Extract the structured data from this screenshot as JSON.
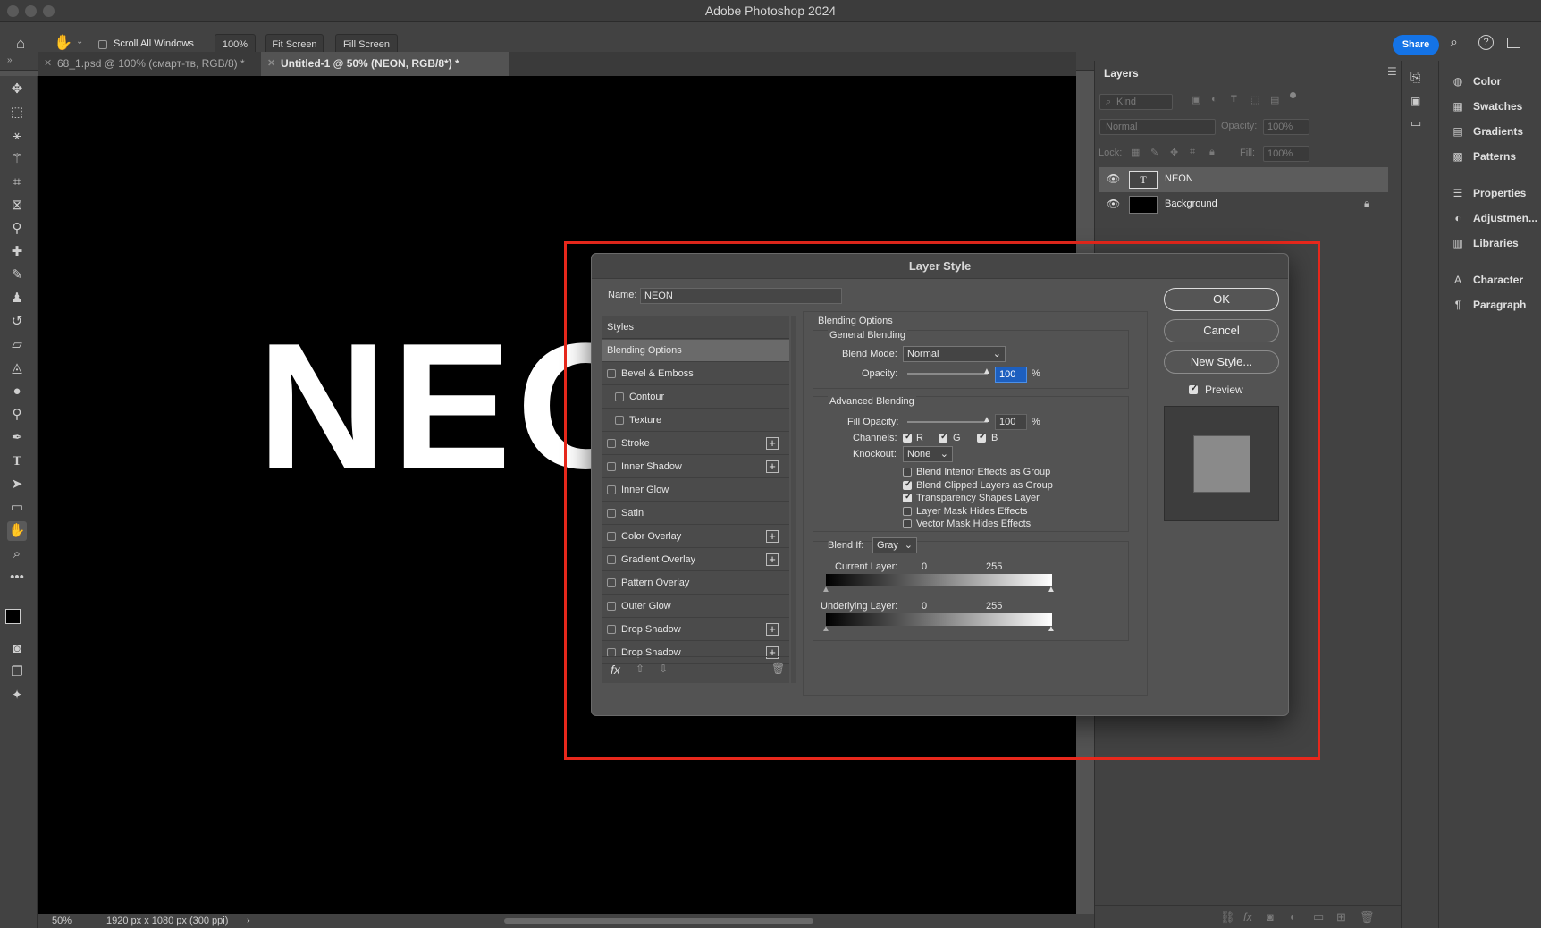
{
  "app": {
    "title": "Adobe Photoshop 2024"
  },
  "options_bar": {
    "scroll_all_windows": "Scroll All Windows",
    "zoom": "100%",
    "fit_screen": "Fit Screen",
    "fill_screen": "Fill Screen",
    "share": "Share"
  },
  "tabs": [
    {
      "label": "68_1.psd @ 100% (смарт-тв, RGB/8) *",
      "active": false
    },
    {
      "label": "Untitled-1 @ 50% (NEON, RGB/8*) *",
      "active": true
    }
  ],
  "canvas": {
    "text": "NEO"
  },
  "status": {
    "zoom": "50%",
    "dims": "1920 px x 1080 px (300 ppi)",
    "arrow": "›"
  },
  "layers_panel": {
    "title": "Layers",
    "kind": "Kind",
    "blend_mode": "Normal",
    "opacity_label": "Opacity:",
    "opacity_value": "100%",
    "lock_label": "Lock:",
    "fill_label": "Fill:",
    "fill_value": "100%",
    "layers": [
      {
        "name": "NEON",
        "type": "text",
        "selected": true
      },
      {
        "name": "Background",
        "type": "fill",
        "locked": true
      }
    ]
  },
  "side_panels": {
    "items": [
      "Color",
      "Swatches",
      "Gradients",
      "Patterns",
      "Properties",
      "Adjustmen...",
      "Libraries",
      "Character",
      "Paragraph"
    ]
  },
  "dialog": {
    "title": "Layer Style",
    "name_label": "Name:",
    "name_value": "NEON",
    "styles_header": "Styles",
    "styles": [
      {
        "label": "Blending Options",
        "checkbox": false,
        "plus": false,
        "selected": true,
        "indent": false
      },
      {
        "label": "Bevel & Emboss",
        "checkbox": true,
        "plus": false,
        "indent": false
      },
      {
        "label": "Contour",
        "checkbox": true,
        "plus": false,
        "indent": true
      },
      {
        "label": "Texture",
        "checkbox": true,
        "plus": false,
        "indent": true
      },
      {
        "label": "Stroke",
        "checkbox": true,
        "plus": true,
        "indent": false
      },
      {
        "label": "Inner Shadow",
        "checkbox": true,
        "plus": true,
        "indent": false
      },
      {
        "label": "Inner Glow",
        "checkbox": true,
        "plus": false,
        "indent": false
      },
      {
        "label": "Satin",
        "checkbox": true,
        "plus": false,
        "indent": false
      },
      {
        "label": "Color Overlay",
        "checkbox": true,
        "plus": true,
        "indent": false
      },
      {
        "label": "Gradient Overlay",
        "checkbox": true,
        "plus": true,
        "indent": false
      },
      {
        "label": "Pattern Overlay",
        "checkbox": true,
        "plus": false,
        "indent": false
      },
      {
        "label": "Outer Glow",
        "checkbox": true,
        "plus": false,
        "indent": false
      },
      {
        "label": "Drop Shadow",
        "checkbox": true,
        "plus": true,
        "indent": false
      },
      {
        "label": "Drop Shadow",
        "checkbox": true,
        "plus": true,
        "indent": false
      }
    ],
    "blending_options": "Blending Options",
    "general_blending": "General Blending",
    "blend_mode_label": "Blend Mode:",
    "blend_mode_value": "Normal",
    "opacity_label": "Opacity:",
    "opacity_value": "100",
    "percent": "%",
    "advanced_blending": "Advanced Blending",
    "fill_opacity_label": "Fill Opacity:",
    "fill_opacity_value": "100",
    "channels_label": "Channels:",
    "channels": [
      "R",
      "G",
      "B"
    ],
    "knockout_label": "Knockout:",
    "knockout_value": "None",
    "adv_options": [
      {
        "label": "Blend Interior Effects as Group",
        "checked": false
      },
      {
        "label": "Blend Clipped Layers as Group",
        "checked": true
      },
      {
        "label": "Transparency Shapes Layer",
        "checked": true
      },
      {
        "label": "Layer Mask Hides Effects",
        "checked": false
      },
      {
        "label": "Vector Mask Hides Effects",
        "checked": false
      }
    ],
    "blend_if_label": "Blend If:",
    "blend_if_value": "Gray",
    "current_layer_label": "Current Layer:",
    "underlying_layer_label": "Underlying Layer:",
    "range_min": "0",
    "range_max": "255",
    "ok": "OK",
    "cancel": "Cancel",
    "new_style": "New Style...",
    "preview_label": "Preview"
  }
}
